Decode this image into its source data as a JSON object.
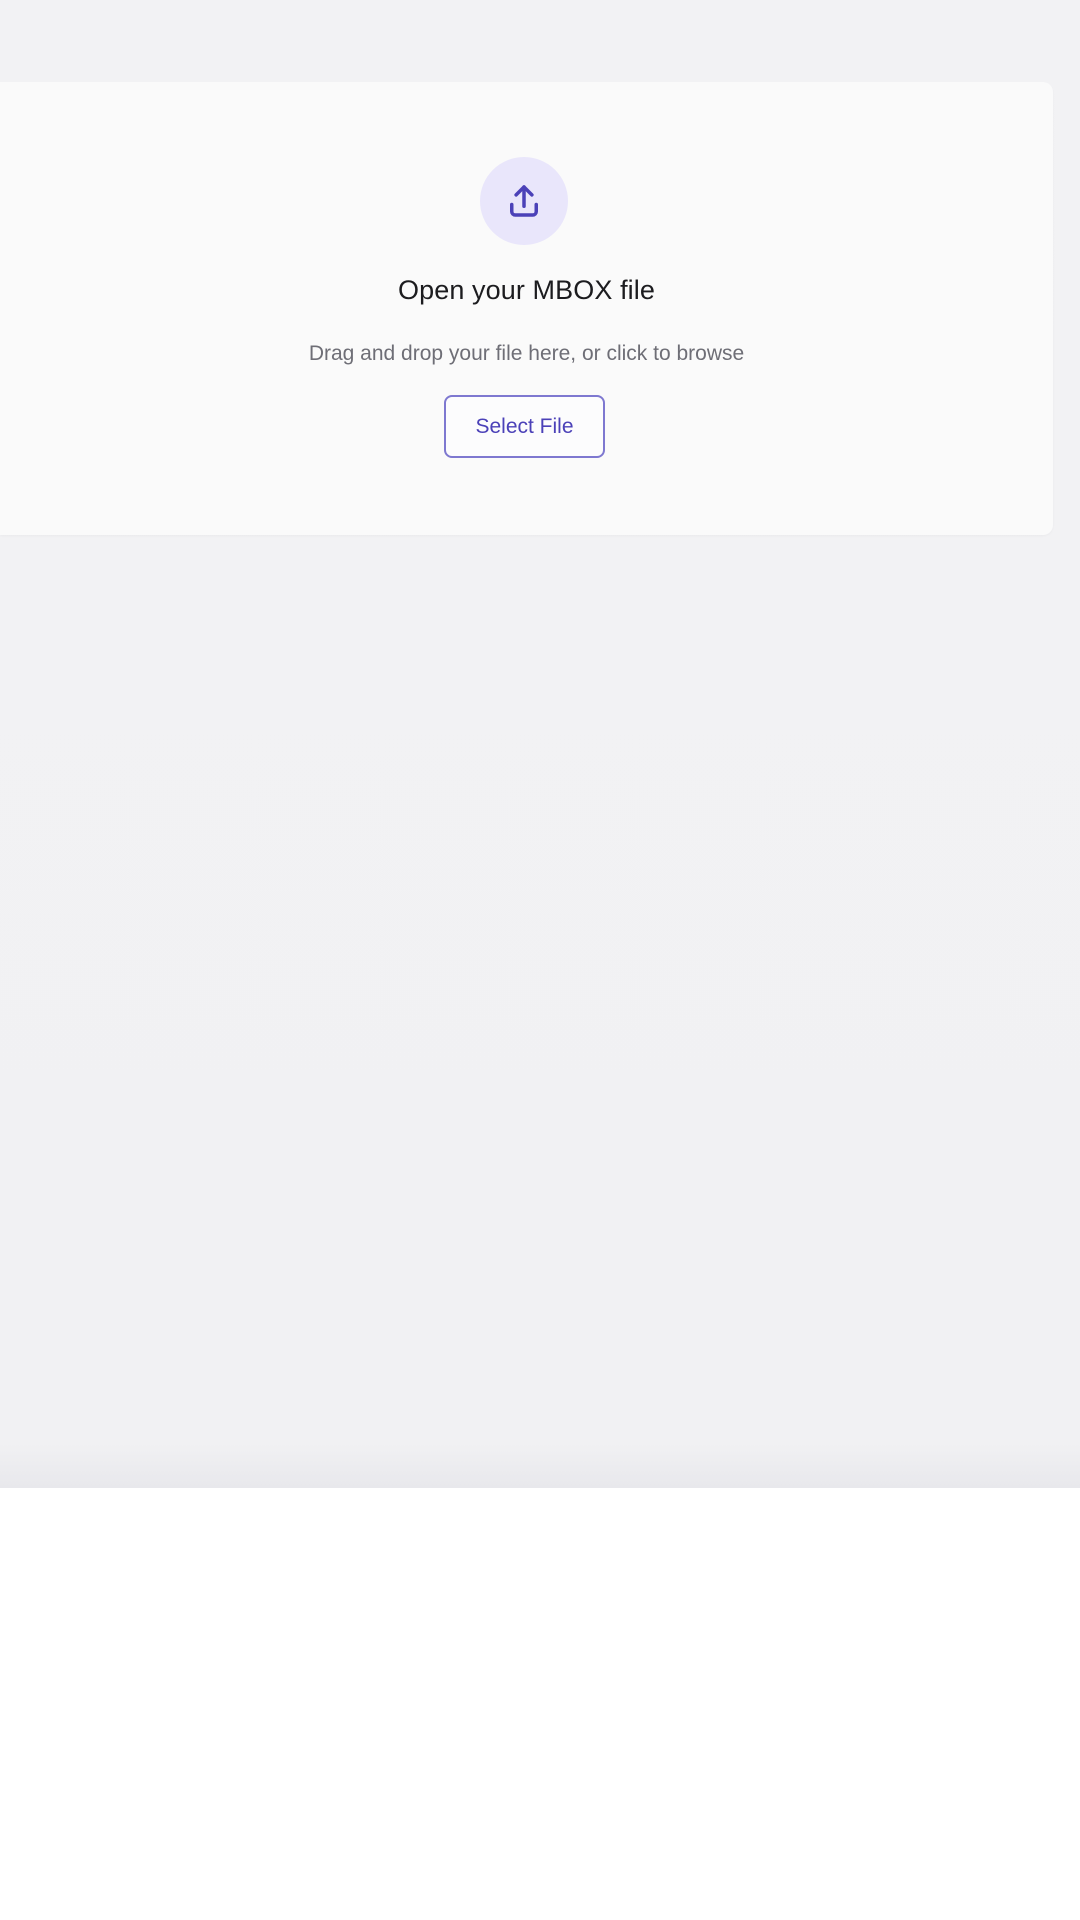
{
  "colors": {
    "accent": "#4b41b8",
    "accent_light": "#e9e6fb",
    "button_border": "#7e78d0",
    "title_text": "#1c1c1f",
    "subtitle_text": "#6e6e76",
    "app_background": "#f2f2f4",
    "card_background": "#fafafa"
  },
  "dropzone": {
    "icon": "upload-icon",
    "title": "Open your MBOX file",
    "subtitle": "Drag and drop your file here, or click to browse",
    "select_button_label": "Select File"
  }
}
